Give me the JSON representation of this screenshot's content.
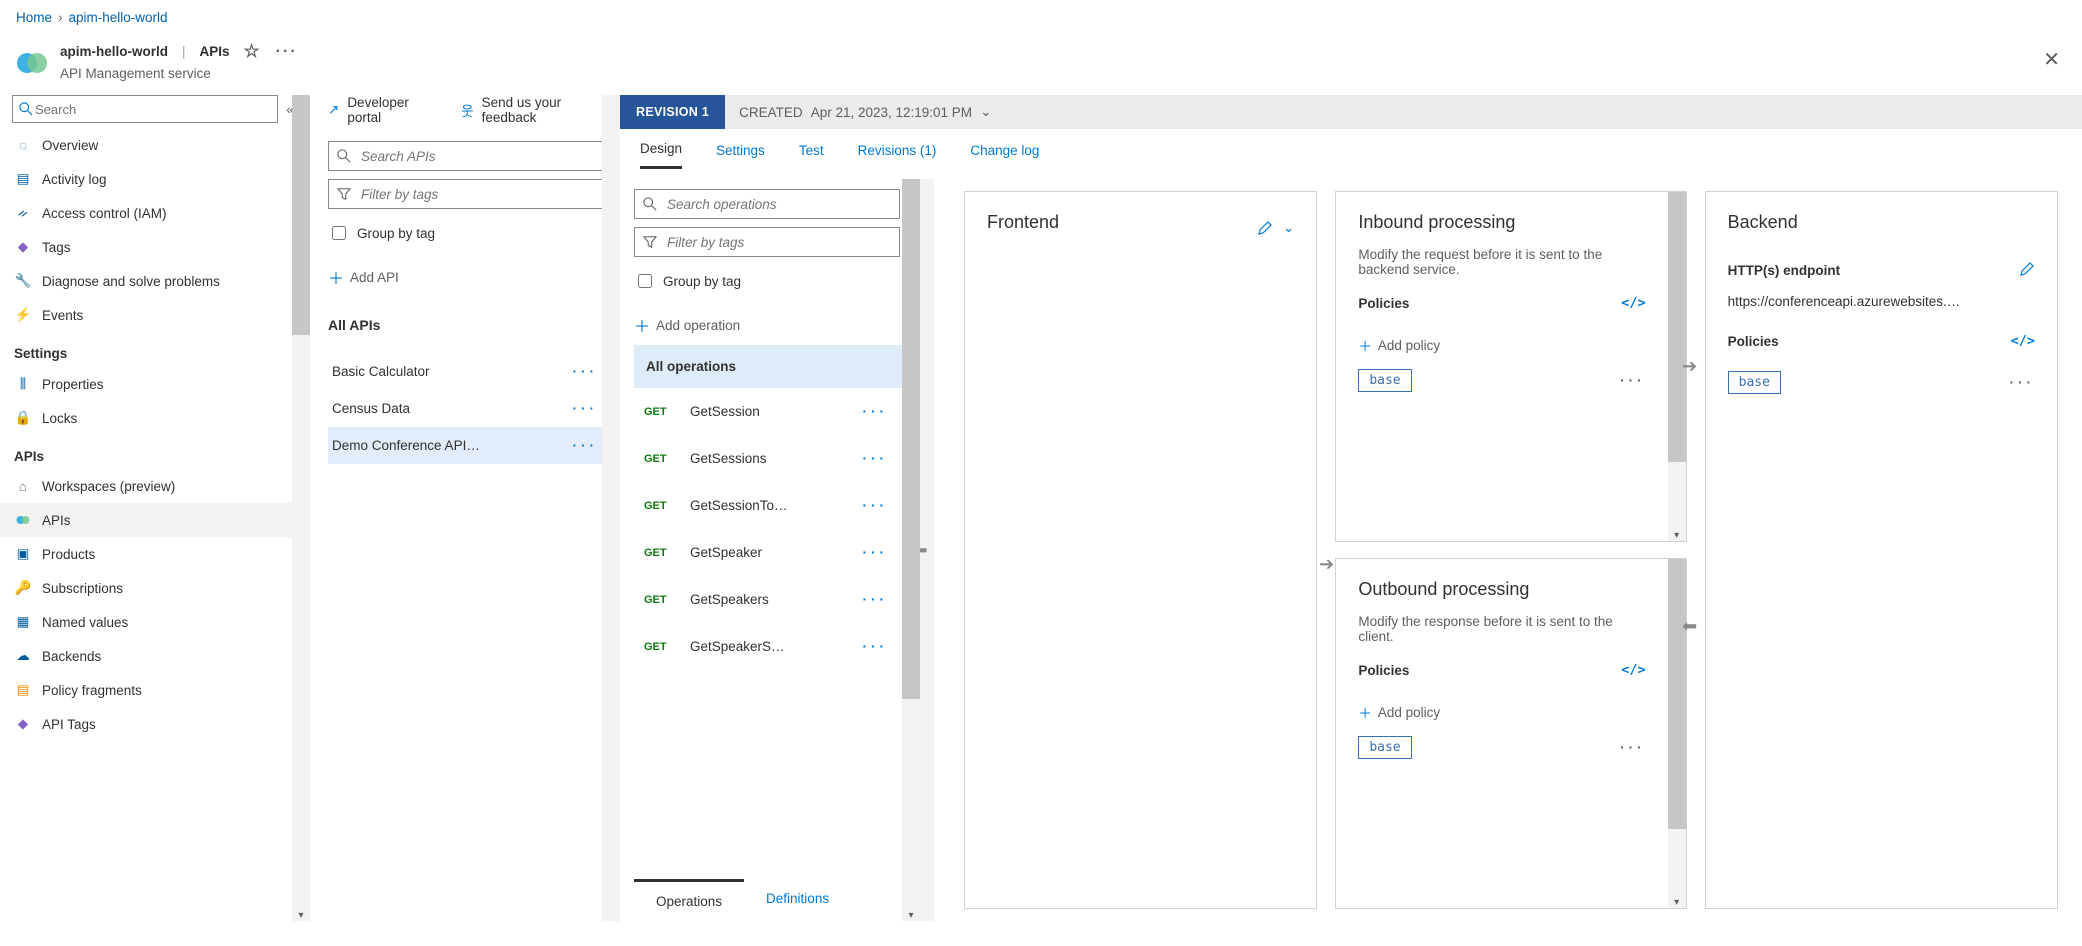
{
  "breadcrumb": {
    "home": "Home",
    "current": "apim-hello-world"
  },
  "title": {
    "name": "apim-hello-world",
    "section": "APIs",
    "subtitle": "API Management service"
  },
  "leftSearch": {
    "placeholder": "Search"
  },
  "nav": {
    "overview": "Overview",
    "activitylog": "Activity log",
    "iam": "Access control (IAM)",
    "tags": "Tags",
    "diagnose": "Diagnose and solve problems",
    "events": "Events",
    "settingsHeader": "Settings",
    "properties": "Properties",
    "locks": "Locks",
    "apisHeader": "APIs",
    "workspaces": "Workspaces (preview)",
    "apis": "APIs",
    "products": "Products",
    "subscriptions": "Subscriptions",
    "namedvalues": "Named values",
    "backends": "Backends",
    "policyfragments": "Policy fragments",
    "apitags": "API Tags"
  },
  "commands": {
    "devportal": "Developer portal",
    "feedback": "Send us your feedback"
  },
  "apisCol": {
    "searchPlaceholder": "Search APIs",
    "filterPlaceholder": "Filter by tags",
    "groupByTag": "Group by tag",
    "addApi": "Add API",
    "allApis": "All APIs",
    "items": [
      {
        "label": "Basic Calculator"
      },
      {
        "label": "Census Data"
      },
      {
        "label": "Demo Conference API…"
      }
    ]
  },
  "revision": {
    "label": "REVISION 1",
    "createdLabel": "CREATED",
    "created": "Apr 21, 2023, 12:19:01 PM"
  },
  "innerTabs": {
    "design": "Design",
    "settings": "Settings",
    "test": "Test",
    "revisions": "Revisions (1)",
    "changelog": "Change log"
  },
  "opsCol": {
    "searchPlaceholder": "Search operations",
    "filterPlaceholder": "Filter by tags",
    "groupByTag": "Group by tag",
    "addOperation": "Add operation",
    "allOperations": "All operations",
    "items": [
      {
        "method": "GET",
        "name": "GetSession"
      },
      {
        "method": "GET",
        "name": "GetSessions"
      },
      {
        "method": "GET",
        "name": "GetSessionTo…"
      },
      {
        "method": "GET",
        "name": "GetSpeaker"
      },
      {
        "method": "GET",
        "name": "GetSpeakers"
      },
      {
        "method": "GET",
        "name": "GetSpeakerS…"
      }
    ],
    "tabs": {
      "operations": "Operations",
      "definitions": "Definitions"
    }
  },
  "frontend": {
    "title": "Frontend"
  },
  "inbound": {
    "title": "Inbound processing",
    "desc": "Modify the request before it is sent to the backend service.",
    "policies": "Policies",
    "addPolicy": "Add policy",
    "base": "base"
  },
  "outbound": {
    "title": "Outbound processing",
    "desc": "Modify the response before it is sent to the client.",
    "policies": "Policies",
    "addPolicy": "Add policy",
    "base": "base"
  },
  "backend": {
    "title": "Backend",
    "endpointLabel": "HTTP(s) endpoint",
    "endpoint": "https://conferenceapi.azurewebsites.…",
    "policies": "Policies",
    "base": "base"
  }
}
